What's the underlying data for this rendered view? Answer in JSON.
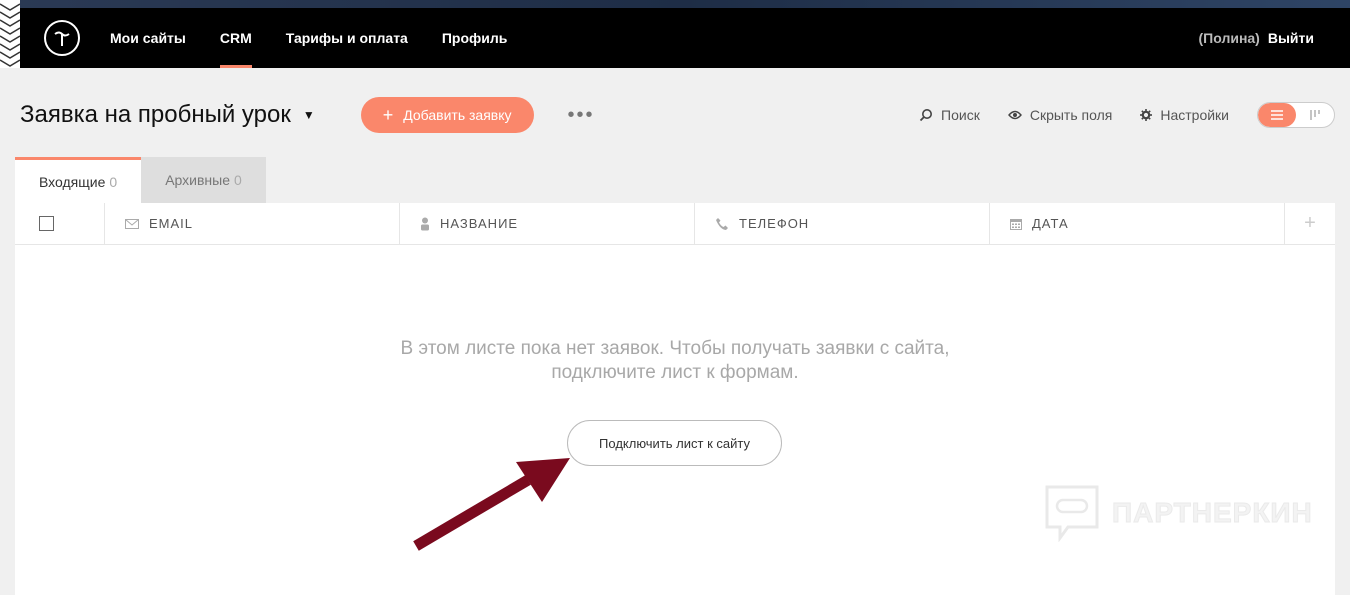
{
  "nav": {
    "items": [
      {
        "label": "Мои сайты"
      },
      {
        "label": "CRM"
      },
      {
        "label": "Тарифы и оплата"
      },
      {
        "label": "Профиль"
      }
    ],
    "user": "(Полина)",
    "logout": "Выйти",
    "accent": "#fa876b"
  },
  "toolbar": {
    "sheet_title": "Заявка на пробный урок",
    "add_label": "Добавить заявку",
    "more_label": "•••",
    "search_label": "Поиск",
    "hide_fields_label": "Скрыть поля",
    "settings_label": "Настройки"
  },
  "tabs": [
    {
      "label": "Входящие",
      "count": "0"
    },
    {
      "label": "Архивные",
      "count": "0"
    }
  ],
  "table": {
    "columns": [
      {
        "label": "EMAIL",
        "icon": "envelope-icon"
      },
      {
        "label": "НАЗВАНИЕ",
        "icon": "user-icon"
      },
      {
        "label": "ТЕЛЕФОН",
        "icon": "phone-icon"
      },
      {
        "label": "ДАТА",
        "icon": "calendar-icon"
      }
    ],
    "add_column": "+"
  },
  "empty": {
    "line1": "В этом листе пока нет заявок. Чтобы получать заявки с сайта,",
    "line2": "подключите лист к формам.",
    "button": "Подключить лист к сайту"
  },
  "watermark": {
    "text": "ПАРТНЕРКИН"
  }
}
